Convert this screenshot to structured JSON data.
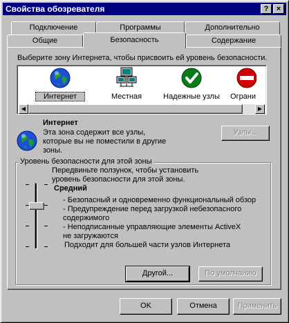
{
  "window": {
    "title": "Свойства обозревателя",
    "help_button": "?",
    "close_button": "×"
  },
  "tabs": {
    "row_top": [
      "Подключение",
      "Программы",
      "Дополнительно"
    ],
    "row_bottom": [
      "Общие",
      "Безопасность",
      "Содержание"
    ],
    "active": "Безопасность"
  },
  "security": {
    "zone_prompt": "Выберите зону Интернета, чтобы присвоить ей уровень безопасности.",
    "zones": [
      {
        "label": "Интернет",
        "icon": "globe-icon",
        "selected": true
      },
      {
        "label": "Местная",
        "icon": "network-computer-icon",
        "selected": false
      },
      {
        "label": "Надежные узлы",
        "icon": "green-check-icon",
        "selected": false
      },
      {
        "label": "Ограни",
        "icon": "restricted-icon",
        "selected": false
      }
    ],
    "selected_zone": {
      "name": "Интернет",
      "description": "Эта зона содержит все узлы, которые вы не поместили в другие зоны."
    },
    "sites_button": "Узлы...",
    "level": {
      "group_title": "Уровень безопасности для этой зоны",
      "slider_hint": "Передвиньте ползунок, чтобы установить уровень безопасности для этой зоны.",
      "level_name": "Средний",
      "bullets": [
        "- Безопасный и одновременно функциональный обзор",
        "- Предупреждение перед загрузкой небезопасного содержимого",
        "- Неподписанные управляющие элементы ActiveX не загружаются",
        "Подходит для большей части узлов Интернета"
      ],
      "custom_button": "Другой...",
      "default_button": "По умолчанию"
    }
  },
  "footer": {
    "ok": "OK",
    "cancel": "Отмена",
    "apply": "Применить"
  },
  "colors": {
    "titlebar": "#000080",
    "face": "#c0c0c0",
    "selection": "#000080"
  }
}
